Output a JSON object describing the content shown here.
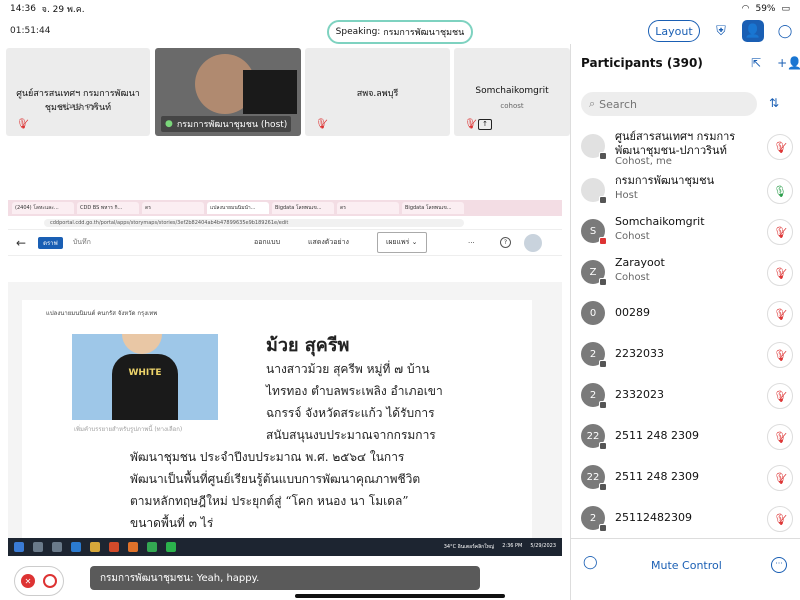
{
  "status": {
    "time": "14:36",
    "date": "จ. 29 พ.ค.",
    "battery": "59%"
  },
  "meeting": {
    "timer": "01:51:44",
    "speaking_prefix": "Speaking:",
    "speaking_name": "กรมการพัฒนาชุมชน"
  },
  "toolbar": {
    "layout_label": "Layout"
  },
  "tiles": [
    {
      "name": "ศูนย์สารสนเทศฯ กรมการพัฒนาชุมชน-ปภาวรินท์",
      "sub": "cohost, me"
    },
    {
      "name": "กรมการพัฒนาชุมชน (host)"
    },
    {
      "name": "สพจ.ลพบุรี"
    },
    {
      "name": "Somchaikomgrit",
      "sub": "cohost"
    }
  ],
  "shared": {
    "tabs": [
      "(2404) โลหะและ...",
      "CDD BS พหาร กิ...",
      "ดร",
      "แปลงนายมนนิมนำ...",
      "Bigdata โลหพนเข...",
      "ดร",
      "Bigdata โลหพนเข..."
    ],
    "url": "cddportal.cdd.go.th/portal/apps/storymaps/stories/3ef2b82404ab4b47899635e9b189261e/edit",
    "app": {
      "chip": "ดราฟ",
      "save": "บันทึก",
      "design": "ออกแบบ",
      "preview": "แสดงตัวอย่าง",
      "publish": "เผยแพร่ ⌄"
    },
    "crumb": "แปลงนายมนนิมนต์ คนกรัส จังหวัด กรุงเทพ",
    "pic_text": "WHITE",
    "pic_caption": "เพิ่มคำบรรยายสำหรับรูปภาพนี้ (ทางเลือก)",
    "title": "ม้วย สุครีพ",
    "body": [
      "นางสาวม้วย สุครีพ หมู่ที่ ๗ บ้าน",
      "ไทรทอง ตำบลพระเพลิง อำเภอเขา",
      "ฉกรรจ์ จังหวัดสระแก้ว ได้รับการ",
      "สนับสนุนงบประมาณจากกรมการ",
      "พัฒนาชุมชน ประจำปีงบประมาณ พ.ศ. ๒๕๖๔ ในการ",
      "พัฒนาเป็นพื้นที่ศูนย์เรียนรู้ต้นแบบการพัฒนาคุณภาพชีวิต",
      "ตามหลักทฤษฎีใหม่ ประยุกต์สู่ “โคก หนอง นา โมเดล”",
      "ขนาดพื้นที่ ๓ ไร่"
    ],
    "taskbar": {
      "weather": "34°C อินเตอร์คลิกใหญ่",
      "clock": "2:36 PM",
      "tdate": "5/29/2023"
    }
  },
  "chat_toast": {
    "sender": "กรมการพัฒนาชุมชน:",
    "message": "Yeah, happy."
  },
  "panel": {
    "title": "Participants (390)",
    "search_placeholder": "Search",
    "participants": [
      {
        "avatar": "",
        "name": "ศูนย์สารสนเทศฯ กรมการพัฒนาชุมชน-ปภาวรินท์",
        "role": "Cohost, me",
        "mic": "muted"
      },
      {
        "avatar": "",
        "name": "กรมการพัฒนาชุมชน",
        "role": "Host",
        "mic": "on"
      },
      {
        "avatar": "S",
        "name": "Somchaikomgrit",
        "role": "Cohost",
        "mic": "muted"
      },
      {
        "avatar": "Z",
        "name": "Zarayoot",
        "role": "Cohost",
        "mic": "muted"
      },
      {
        "avatar": "0",
        "name": "00289",
        "role": "",
        "mic": "muted"
      },
      {
        "avatar": "2",
        "name": "2232033",
        "role": "",
        "mic": "muted"
      },
      {
        "avatar": "2",
        "name": "2332023",
        "role": "",
        "mic": "muted"
      },
      {
        "avatar": "22",
        "name": "2511 248 2309",
        "role": "",
        "mic": "muted"
      },
      {
        "avatar": "22",
        "name": "2511 248 2309",
        "role": "",
        "mic": "muted"
      },
      {
        "avatar": "2",
        "name": "25112482309",
        "role": "",
        "mic": "muted"
      }
    ],
    "footer": {
      "mute_control": "Mute Control"
    }
  },
  "colors": {
    "accent": "#1a5fb4",
    "muted_red": "#dd3333",
    "speaking_border": "#7ed2c0"
  }
}
